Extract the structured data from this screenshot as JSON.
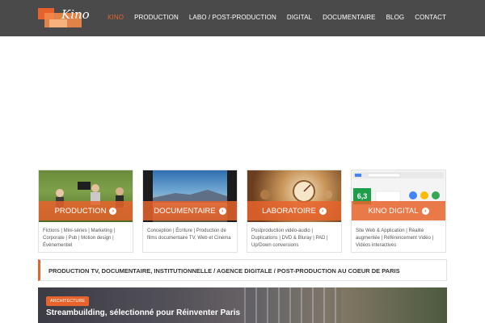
{
  "header": {
    "logo_text": "Kino",
    "nav": [
      {
        "label": "KINO",
        "active": true
      },
      {
        "label": "PRODUCTION",
        "active": false
      },
      {
        "label": "LABO / POST-PRODUCTION",
        "active": false
      },
      {
        "label": "DIGITAL",
        "active": false
      },
      {
        "label": "DOCUMENTAIRE",
        "active": false
      },
      {
        "label": "BLOG",
        "active": false
      },
      {
        "label": "CONTACT",
        "active": false
      }
    ]
  },
  "cards": [
    {
      "label": "PRODUCTION",
      "desc": "Fictions | Mini-séries | Marketing | Corporate | Pub | Motion design | Événementiel"
    },
    {
      "label": "DOCUMENTAIRE",
      "desc": "Conception | Écriture | Production de films documentaire TV, Web et Cinéma"
    },
    {
      "label": "LABORATOIRE",
      "desc": "Postproduction vidéo-audio | Duplications | DVD & Bluray | PAD | Up/Down conversions"
    },
    {
      "label": "KINO DIGITAL",
      "desc": "Site Web & Application | Réalité augmentée | Référencement Vidéo | Vidéos interactives",
      "stat": "6,3"
    }
  ],
  "tagline": "PRODUCTION TV, DOCUMENTAIRE, INSTITUTIONNELLE / AGENCE DIGITALE / POST-PRODUCTION AU COEUR DE PARIS",
  "feature": {
    "category": "ARCHITECTURE",
    "title": "Streambuilding, sélectionné pour Réinventer Paris"
  },
  "colors": {
    "accent": "#e8632b",
    "header_bg": "#4a4a4a"
  }
}
